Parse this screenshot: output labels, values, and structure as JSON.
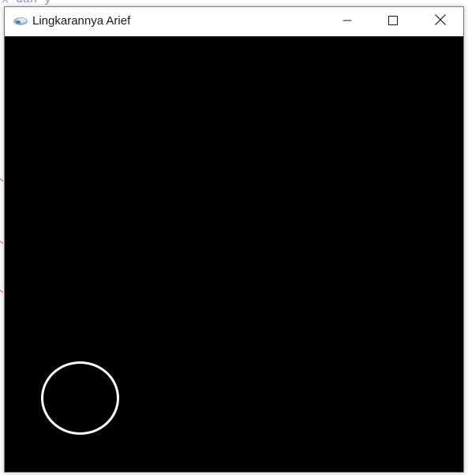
{
  "background_editor": {
    "code_fragment": "x dan y"
  },
  "window": {
    "title": "Lingkarannya Arief",
    "app_icon": "opengl-glut-icon",
    "controls": {
      "minimize_icon": "minimize-icon",
      "maximize_icon": "maximize-icon",
      "close_icon": "close-icon"
    },
    "canvas": {
      "background_color": "#000000",
      "shape": "circle",
      "stroke_color": "#ffffff"
    }
  }
}
